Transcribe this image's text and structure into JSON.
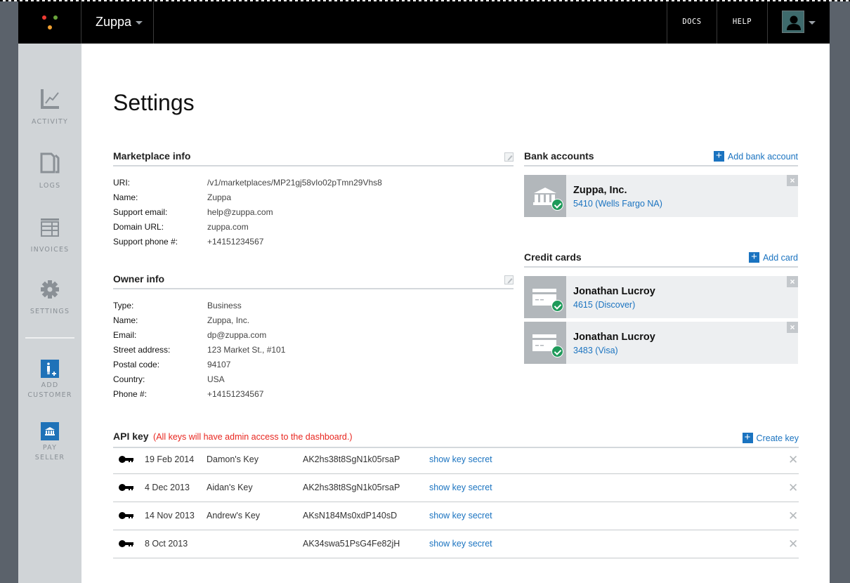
{
  "topbar": {
    "brand": "Zuppa",
    "logo_colors": [
      "#ee3b33",
      "#6aa53c",
      "#f0a030"
    ],
    "links": [
      "DOCS",
      "HELP"
    ],
    "user_icon": "user-avatar-icon"
  },
  "sidebar": {
    "items": [
      {
        "label": "ACTIVITY",
        "icon": "chart-line-icon"
      },
      {
        "label": "LOGS",
        "icon": "document-icon"
      },
      {
        "label": "INVOICES",
        "icon": "table-icon"
      },
      {
        "label": "SETTINGS",
        "icon": "gear-icon"
      }
    ],
    "actions": [
      {
        "line1": "ADD",
        "line2": "CUSTOMER",
        "icon": "add-person-icon"
      },
      {
        "line1": "PAY",
        "line2": "SELLER",
        "icon": "bank-icon"
      }
    ],
    "accent": "#1f72b8"
  },
  "page": {
    "title": "Settings"
  },
  "marketplace": {
    "title": "Marketplace info",
    "rows": [
      {
        "k": "URI:",
        "v": "/v1/marketplaces/MP21gj58vIo02pTmn29Vhs8"
      },
      {
        "k": "Name:",
        "v": "Zuppa"
      },
      {
        "k": "Support email:",
        "v": "help@zuppa.com"
      },
      {
        "k": "Domain URL:",
        "v": "zuppa.com"
      },
      {
        "k": "Support phone #:",
        "v": "+14151234567"
      }
    ]
  },
  "owner": {
    "title": "Owner info",
    "rows": [
      {
        "k": "Type:",
        "v": "Business"
      },
      {
        "k": "Name:",
        "v": "Zuppa, Inc."
      },
      {
        "k": "Email:",
        "v": "dp@zuppa.com"
      },
      {
        "k": "Street address:",
        "v": "123 Market St., #101"
      },
      {
        "k": "Postal code:",
        "v": "94107"
      },
      {
        "k": "Country:",
        "v": "USA"
      },
      {
        "k": "Phone #:",
        "v": "+14151234567"
      }
    ]
  },
  "bank": {
    "title": "Bank accounts",
    "add_label": "Add bank account",
    "items": [
      {
        "name": "Zuppa, Inc.",
        "detail": "5410 (Wells Fargo NA)",
        "verified": true
      }
    ]
  },
  "cards": {
    "title": "Credit cards",
    "add_label": "Add card",
    "items": [
      {
        "name": "Jonathan Lucroy",
        "detail": "4615 (Discover)",
        "verified": true
      },
      {
        "name": "Jonathan Lucroy",
        "detail": "3483 (Visa)",
        "verified": true
      }
    ]
  },
  "api": {
    "title": "API key",
    "warning": "(All keys will have admin access to the dashboard.)",
    "create_label": "Create key",
    "show_label": "show key secret",
    "delete_symbol": "✕",
    "keys": [
      {
        "date": "19 Feb 2014",
        "name": "Damon's Key",
        "key": "AK2hs38t8SgN1k05rsaP"
      },
      {
        "date": "4 Dec 2013",
        "name": "Aidan's Key",
        "key": "AK2hs38t8SgN1k05rsaP"
      },
      {
        "date": "14 Nov 2013",
        "name": "Andrew's Key",
        "key": "AKsN184Ms0xdP140sD"
      },
      {
        "date": "8 Oct 2013",
        "name": "",
        "key": "AK34swa51PsG4Fe82jH"
      }
    ]
  },
  "colors": {
    "link": "#1a73c0",
    "warning": "#e8261f",
    "success": "#1e9a5a"
  }
}
